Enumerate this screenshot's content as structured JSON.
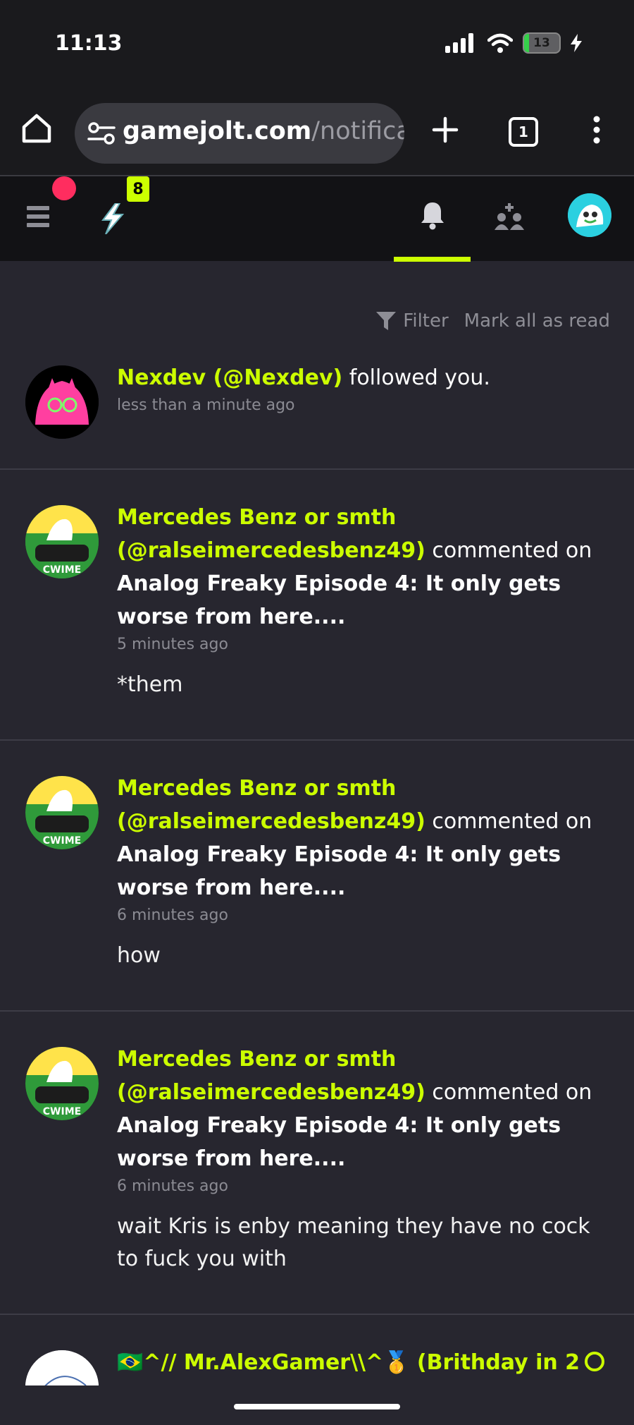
{
  "status_bar": {
    "time": "11:13",
    "battery": "13"
  },
  "browser": {
    "url_host": "gamejolt.com",
    "url_path": "/notificat",
    "tab_count": "1"
  },
  "app_nav": {
    "notification_badge": "8"
  },
  "filter": {
    "filter_label": "Filter",
    "mark_all_label": "Mark all as read"
  },
  "notifications": [
    {
      "user": "Nexdev (@Nexdev)",
      "action": " followed you.",
      "time": "less than a minute ago"
    },
    {
      "user_line1": "Mercedes Benz or smth",
      "user_line2": "(@ralseimercedesbenz49)",
      "action": " commented on",
      "target": "Analog Freaky Episode 4: It only gets worse from here....",
      "time": "5 minutes ago",
      "comment": "*them"
    },
    {
      "user_line1": "Mercedes Benz or smth",
      "user_line2": "(@ralseimercedesbenz49)",
      "action": " commented on",
      "target": "Analog Freaky Episode 4: It only gets worse from here....",
      "time": "6 minutes ago",
      "comment": "how"
    },
    {
      "user_line1": "Mercedes Benz or smth",
      "user_line2": "(@ralseimercedesbenz49)",
      "action": " commented on",
      "target": "Analog Freaky Episode 4: It only gets worse from here....",
      "time": "6 minutes ago",
      "comment": "wait Kris is enby meaning they have no cock to fuck you with"
    },
    {
      "user": "🇧🇷^// Mr.AlexGamer\\\\^🥇 (Brithday in 2"
    }
  ],
  "colors": {
    "accent": "#ccff00",
    "background": "#27262f",
    "nav": "#121215",
    "alert": "#ff2d5f"
  }
}
